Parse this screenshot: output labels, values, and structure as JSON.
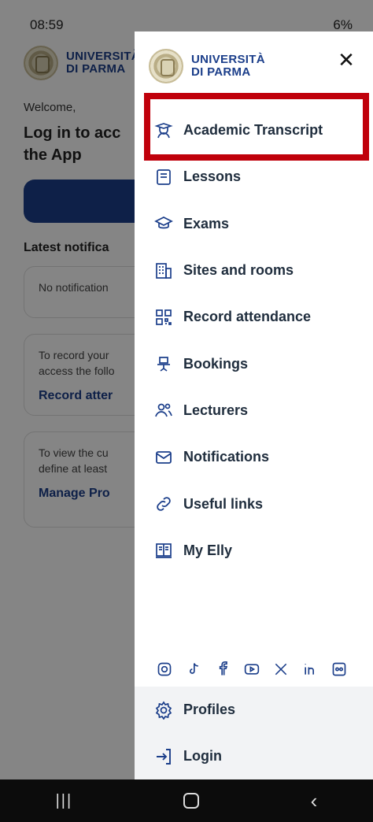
{
  "status_bar": {
    "time": "08:59",
    "battery": "6%"
  },
  "background": {
    "logo_line1": "UNIVERSITÀ",
    "logo_line2": "DI PARMA",
    "welcome": "Welcome,",
    "login_heading": "Log in to acc the App",
    "latest_heading": "Latest notifica",
    "cards": [
      {
        "text": "No notification",
        "link": ""
      },
      {
        "text": "To record your access the follo",
        "link": "Record atter"
      },
      {
        "text": "To view the cu define at least",
        "link": "Manage Pro"
      }
    ]
  },
  "drawer": {
    "logo_line1": "UNIVERSITÀ",
    "logo_line2": "DI PARMA",
    "close_symbol": "✕",
    "items": [
      {
        "label": "Academic Transcript",
        "icon": "graduate-icon"
      },
      {
        "label": "Lessons",
        "icon": "book-icon"
      },
      {
        "label": "Exams",
        "icon": "mortarboard-icon"
      },
      {
        "label": "Sites and rooms",
        "icon": "building-icon"
      },
      {
        "label": "Record attendance",
        "icon": "qr-code-icon"
      },
      {
        "label": "Bookings",
        "icon": "desk-chair-icon"
      },
      {
        "label": "Lecturers",
        "icon": "people-icon"
      },
      {
        "label": "Notifications",
        "icon": "mail-icon"
      },
      {
        "label": "Useful links",
        "icon": "link-icon"
      },
      {
        "label": "My Elly",
        "icon": "elly-book-icon"
      }
    ],
    "social": [
      "instagram-icon",
      "tiktok-icon",
      "facebook-icon",
      "youtube-icon",
      "x-icon",
      "linkedin-icon",
      "flickr-icon"
    ],
    "footer": [
      {
        "label": "Profiles",
        "icon": "gear-icon"
      },
      {
        "label": "Login",
        "icon": "login-arrow-icon"
      }
    ]
  },
  "colors": {
    "brand": "#1b3e8a",
    "highlight": "#c0000b"
  }
}
